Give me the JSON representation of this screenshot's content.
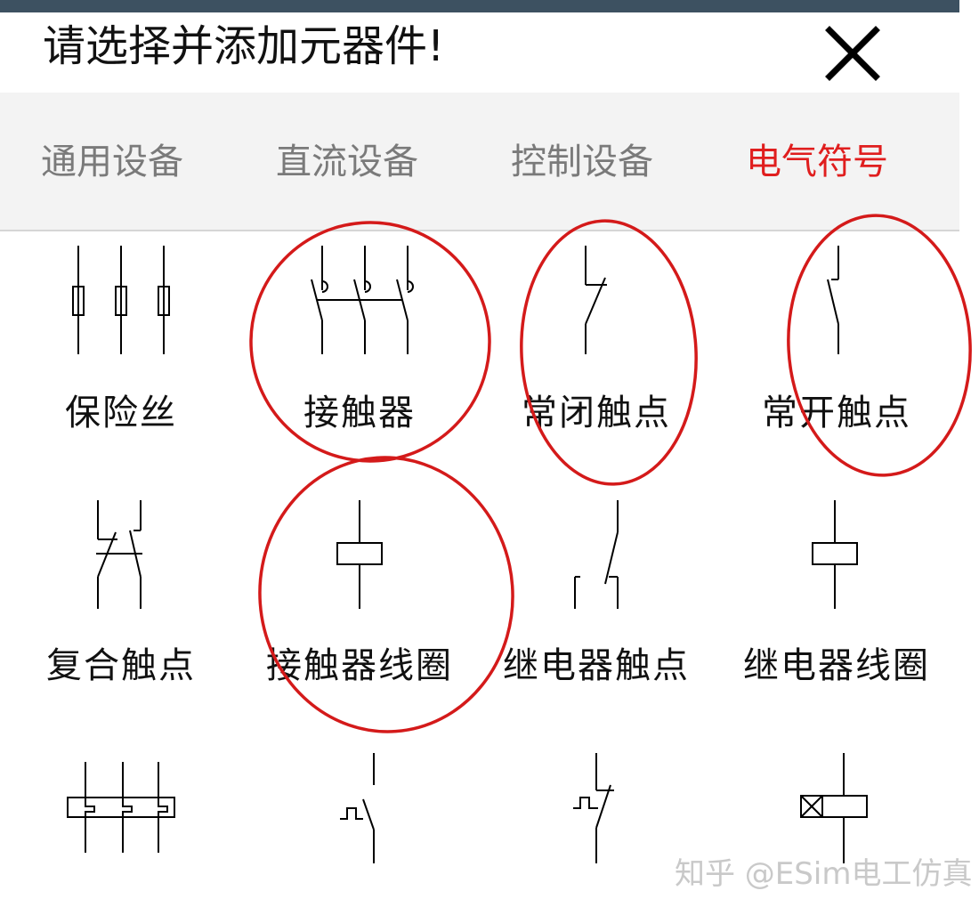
{
  "dialog": {
    "title": "请选择并添加元器件!",
    "close_icon": "close-x-icon"
  },
  "tabs": [
    {
      "label": "通用设备",
      "active": false
    },
    {
      "label": "直流设备",
      "active": false
    },
    {
      "label": "控制设备",
      "active": false
    },
    {
      "label": "电气符号",
      "active": true
    }
  ],
  "items": [
    {
      "label": "保险丝",
      "icon": "fuse-icon",
      "circled": false
    },
    {
      "label": "接触器",
      "icon": "contactor-icon",
      "circled": true
    },
    {
      "label": "常闭触点",
      "icon": "normally-closed-contact-icon",
      "circled": true
    },
    {
      "label": "常开触点",
      "icon": "normally-open-contact-icon",
      "circled": true
    },
    {
      "label": "复合触点",
      "icon": "compound-contact-icon",
      "circled": false
    },
    {
      "label": "接触器线圈",
      "icon": "contactor-coil-icon",
      "circled": true
    },
    {
      "label": "继电器触点",
      "icon": "relay-contact-icon",
      "circled": false
    },
    {
      "label": "继电器线圈",
      "icon": "relay-coil-icon",
      "circled": false
    },
    {
      "label": "",
      "icon": "thermal-overload-relay-icon",
      "circled": false
    },
    {
      "label": "",
      "icon": "delay-contact-icon",
      "circled": false
    },
    {
      "label": "",
      "icon": "delay-break-contact-icon",
      "circled": false
    },
    {
      "label": "",
      "icon": "time-relay-coil-icon",
      "circled": false
    }
  ],
  "colors": {
    "accent": "#e01e1e",
    "header_bar": "#3d5161",
    "tab_inactive": "#7a7a7a",
    "tabs_background": "#f3f3f3",
    "annotation_circle": "#d41a1a"
  },
  "watermark": "知乎 @ESim电工仿真"
}
